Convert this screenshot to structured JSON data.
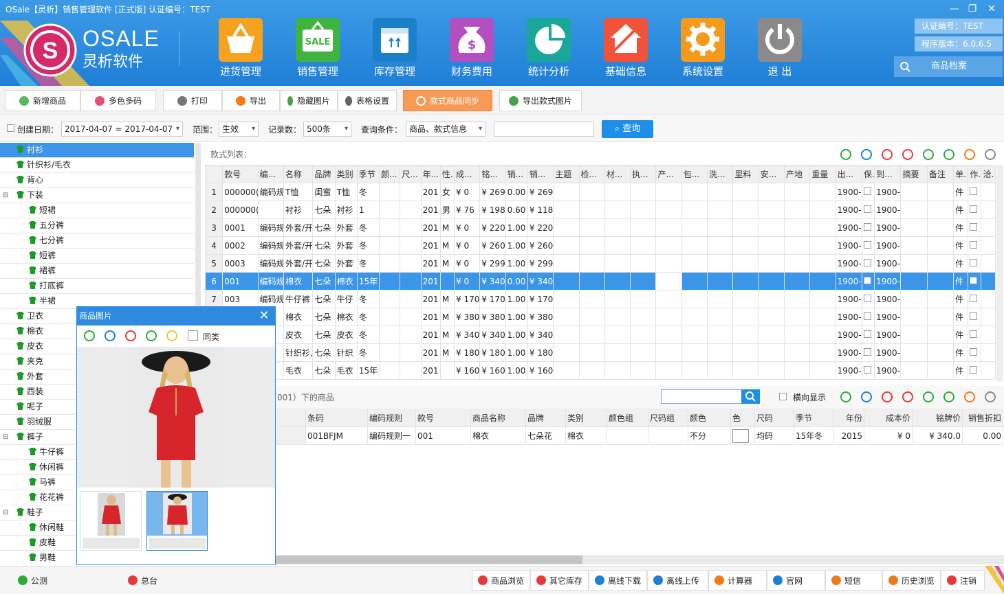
{
  "window": {
    "title": "OSale【灵析】销售管理软件 [正式版] 认证编号：TEST"
  },
  "logo": {
    "brand": "OSALE",
    "cn": "灵析软件"
  },
  "modules": [
    {
      "label": "进货管理",
      "color": "#f6a21e",
      "icon": "basket-icon"
    },
    {
      "label": "销售管理",
      "color": "#3fb53f",
      "icon": "sale-tag-icon",
      "badge": "SALE"
    },
    {
      "label": "库存管理",
      "color": "#1b7fc9",
      "icon": "box-icon"
    },
    {
      "label": "财务费用",
      "color": "#b34fbe",
      "icon": "money-bag-icon"
    },
    {
      "label": "统计分析",
      "color": "#1aa79a",
      "icon": "pie-chart-icon"
    },
    {
      "label": "基础信息",
      "color": "#f0533a",
      "icon": "house-icon"
    },
    {
      "label": "系统设置",
      "color": "#f69a1b",
      "icon": "gear-icon"
    },
    {
      "label": "退 出",
      "color": "#8a8a8a",
      "icon": "power-icon"
    }
  ],
  "info": {
    "cert": "认证编号：TEST",
    "version": "程序版本：6.0.6.5",
    "archive": "商品档案"
  },
  "toolbar": [
    "新增商品",
    "多色多码",
    "打印",
    "导出",
    "隐藏图片",
    "表格设置",
    "款式商品同步",
    "导出款式图片"
  ],
  "filter": {
    "date_label": "创建日期：",
    "date_value": "2017-04-07 ≈ 2017-04-07",
    "scope_label": "范围：",
    "scope_value": "生效",
    "count_label": "记录数：",
    "count_value": "500条",
    "cond_label": "查询条件：",
    "cond_value": "商品、款式信息",
    "query": "查询"
  },
  "tree": [
    {
      "label": "衬衫",
      "lvl": 0,
      "sel": true
    },
    {
      "label": "针织衫/毛衣",
      "lvl": 0
    },
    {
      "label": "背心",
      "lvl": 0
    },
    {
      "label": "下装",
      "lvl": 0,
      "exp": true
    },
    {
      "label": "短裙",
      "lvl": 1
    },
    {
      "label": "五分裤",
      "lvl": 1
    },
    {
      "label": "七分裤",
      "lvl": 1
    },
    {
      "label": "短裤",
      "lvl": 1
    },
    {
      "label": "裙裤",
      "lvl": 1
    },
    {
      "label": "打底裤",
      "lvl": 1
    },
    {
      "label": "半裙",
      "lvl": 1
    },
    {
      "label": "卫衣",
      "lvl": 0
    },
    {
      "label": "棉衣",
      "lvl": 0
    },
    {
      "label": "皮衣",
      "lvl": 0
    },
    {
      "label": "夹克",
      "lvl": 0
    },
    {
      "label": "外套",
      "lvl": 0
    },
    {
      "label": "西装",
      "lvl": 0
    },
    {
      "label": "呢子",
      "lvl": 0
    },
    {
      "label": "羽绒服",
      "lvl": 0
    },
    {
      "label": "裤子",
      "lvl": 0,
      "exp": true
    },
    {
      "label": "牛仔裤",
      "lvl": 1
    },
    {
      "label": "休闲裤",
      "lvl": 1
    },
    {
      "label": "马裤",
      "lvl": 1
    },
    {
      "label": "花花裤",
      "lvl": 1
    },
    {
      "label": "鞋子",
      "lvl": 0,
      "exp": true
    },
    {
      "label": "休闲鞋",
      "lvl": 1
    },
    {
      "label": "皮鞋",
      "lvl": 1
    },
    {
      "label": "男鞋",
      "lvl": 1
    }
  ],
  "grid": {
    "title": "款式列表：",
    "headers": [
      "",
      "款号",
      "编...",
      "名称",
      "品牌",
      "类别",
      "季节",
      "颜...",
      "尺...",
      "年...",
      "性.",
      "成...",
      "铭...",
      "销...",
      "销...",
      "主题",
      "检...",
      "材...",
      "执...",
      "产...",
      "包...",
      "洗...",
      "里料",
      "安...",
      "产地",
      "重量",
      "出...",
      "保.",
      "到...",
      "摘要",
      "备注",
      "单.",
      "作.",
      "洽."
    ],
    "rows": [
      [
        "1",
        "000000(",
        "编码规",
        "T恤",
        "闺蜜",
        "T恤",
        "冬",
        "",
        "",
        "201",
        "女",
        "¥ 0",
        "¥ 269",
        "0.00",
        "¥ 269",
        "",
        "",
        "",
        "",
        "",
        "",
        "",
        "",
        "",
        "",
        "",
        "1900-",
        "",
        "1900-",
        "",
        "",
        "件",
        "",
        ""
      ],
      [
        "2",
        "000000(",
        "",
        "衬衫",
        "七朵",
        "衬衫",
        "1",
        "",
        "",
        "201",
        "男",
        "¥ 76",
        "¥ 198",
        "0.60",
        "¥ 118",
        "",
        "",
        "",
        "",
        "",
        "",
        "",
        "",
        "",
        "",
        "",
        "1900-",
        "",
        "1900-",
        "",
        "",
        "件",
        "",
        ""
      ],
      [
        "3",
        "0001",
        "编码规",
        "外套/开",
        "七朵",
        "外套",
        "冬",
        "",
        "",
        "201",
        "M",
        "¥ 0",
        "¥ 220",
        "1.00",
        "¥ 220",
        "",
        "",
        "",
        "",
        "",
        "",
        "",
        "",
        "",
        "",
        "",
        "1900-",
        "",
        "1900-",
        "",
        "",
        "件",
        "",
        ""
      ],
      [
        "4",
        "0002",
        "编码规",
        "外套/开",
        "七朵",
        "外套",
        "冬",
        "",
        "",
        "201",
        "M",
        "¥ 0",
        "¥ 260",
        "1.00",
        "¥ 260",
        "",
        "",
        "",
        "",
        "",
        "",
        "",
        "",
        "",
        "",
        "",
        "1900-",
        "",
        "1900-",
        "",
        "",
        "件",
        "",
        ""
      ],
      [
        "5",
        "0003",
        "编码规",
        "外套/开",
        "七朵",
        "外套",
        "冬",
        "",
        "",
        "201",
        "M",
        "¥ 0",
        "¥ 299",
        "1.00",
        "¥ 299",
        "",
        "",
        "",
        "",
        "",
        "",
        "",
        "",
        "",
        "",
        "",
        "1900-",
        "",
        "1900-",
        "",
        "",
        "件",
        "",
        ""
      ],
      [
        "6",
        "001",
        "编码规",
        "棉衣",
        "七朵",
        "棉衣",
        "15年",
        "",
        "",
        "201",
        "",
        "¥ 0",
        "¥ 340",
        "0.00",
        "¥ 340",
        "",
        "",
        "",
        "",
        "",
        "",
        "",
        "",
        "",
        "",
        "",
        "1900-",
        "",
        "1900-",
        "",
        "",
        "件",
        "",
        ""
      ],
      [
        "7",
        "003",
        "编码规",
        "牛仔裤",
        "七朵",
        "牛仔",
        "冬",
        "",
        "",
        "201",
        "M",
        "¥ 170",
        "¥ 170",
        "1.00",
        "¥ 170",
        "",
        "",
        "",
        "",
        "",
        "",
        "",
        "",
        "",
        "",
        "",
        "1900-",
        "",
        "1900-",
        "",
        "",
        "件",
        "",
        ""
      ],
      [
        "8",
        "",
        "规",
        "棉衣",
        "七朵",
        "棉衣",
        "冬",
        "",
        "",
        "201",
        "M",
        "¥ 380",
        "¥ 380",
        "1.00",
        "¥ 380",
        "",
        "",
        "",
        "",
        "",
        "",
        "",
        "",
        "",
        "",
        "",
        "1900-",
        "",
        "1900-",
        "",
        "",
        "件",
        "",
        ""
      ],
      [
        "9",
        "",
        "规",
        "皮衣",
        "七朵",
        "皮衣",
        "冬",
        "",
        "",
        "201",
        "M",
        "¥ 340",
        "¥ 340",
        "1.00",
        "¥ 340",
        "",
        "",
        "",
        "",
        "",
        "",
        "",
        "",
        "",
        "",
        "",
        "1900-",
        "",
        "1900-",
        "",
        "",
        "件",
        "",
        ""
      ],
      [
        "10",
        "",
        "规",
        "针织衫,",
        "七朵",
        "针织",
        "冬",
        "",
        "",
        "201",
        "M",
        "¥ 180",
        "¥ 180",
        "1.00",
        "¥ 180",
        "",
        "",
        "",
        "",
        "",
        "",
        "",
        "",
        "",
        "",
        "",
        "1900-",
        "",
        "1900-",
        "",
        "",
        "件",
        "",
        ""
      ],
      [
        "11",
        "",
        "规",
        "毛衣",
        "七朵",
        "毛衣",
        "15年",
        "",
        "",
        "201",
        "",
        "¥ 160",
        "¥ 160",
        "1.00",
        "¥ 160",
        "",
        "",
        "",
        "",
        "",
        "",
        "",
        "",
        "",
        "",
        "",
        "1900-",
        "",
        "1900-",
        "",
        "",
        "件",
        "",
        ""
      ]
    ]
  },
  "lower": {
    "title": "001）下的商品",
    "horizontal": "横向显示",
    "headers": [
      "",
      "条码",
      "编码规则",
      "款号",
      "商品名称",
      "品牌",
      "类别",
      "颜色组",
      "尺码组",
      "颜色",
      "色",
      "尺码",
      "季节",
      "年份",
      "成本价",
      "铭牌价",
      "销售折扣"
    ],
    "rows": [
      [
        "",
        "001BFJM",
        "编码规则一",
        "001",
        "棉衣",
        "七朵花",
        "棉衣",
        "",
        "",
        "不分",
        "",
        "均码",
        "15年冬",
        "2015",
        "¥ 0",
        "¥ 340.0",
        "0.00"
      ]
    ]
  },
  "dialog": {
    "title": "商品图片",
    "same": "同类"
  },
  "bottom": {
    "left": [
      "公测",
      "总台"
    ],
    "right": [
      "商品浏览",
      "其它库存",
      "离线下载",
      "离线上传",
      "计算器",
      "官网",
      "短信",
      "历史浏览",
      "注销"
    ]
  }
}
